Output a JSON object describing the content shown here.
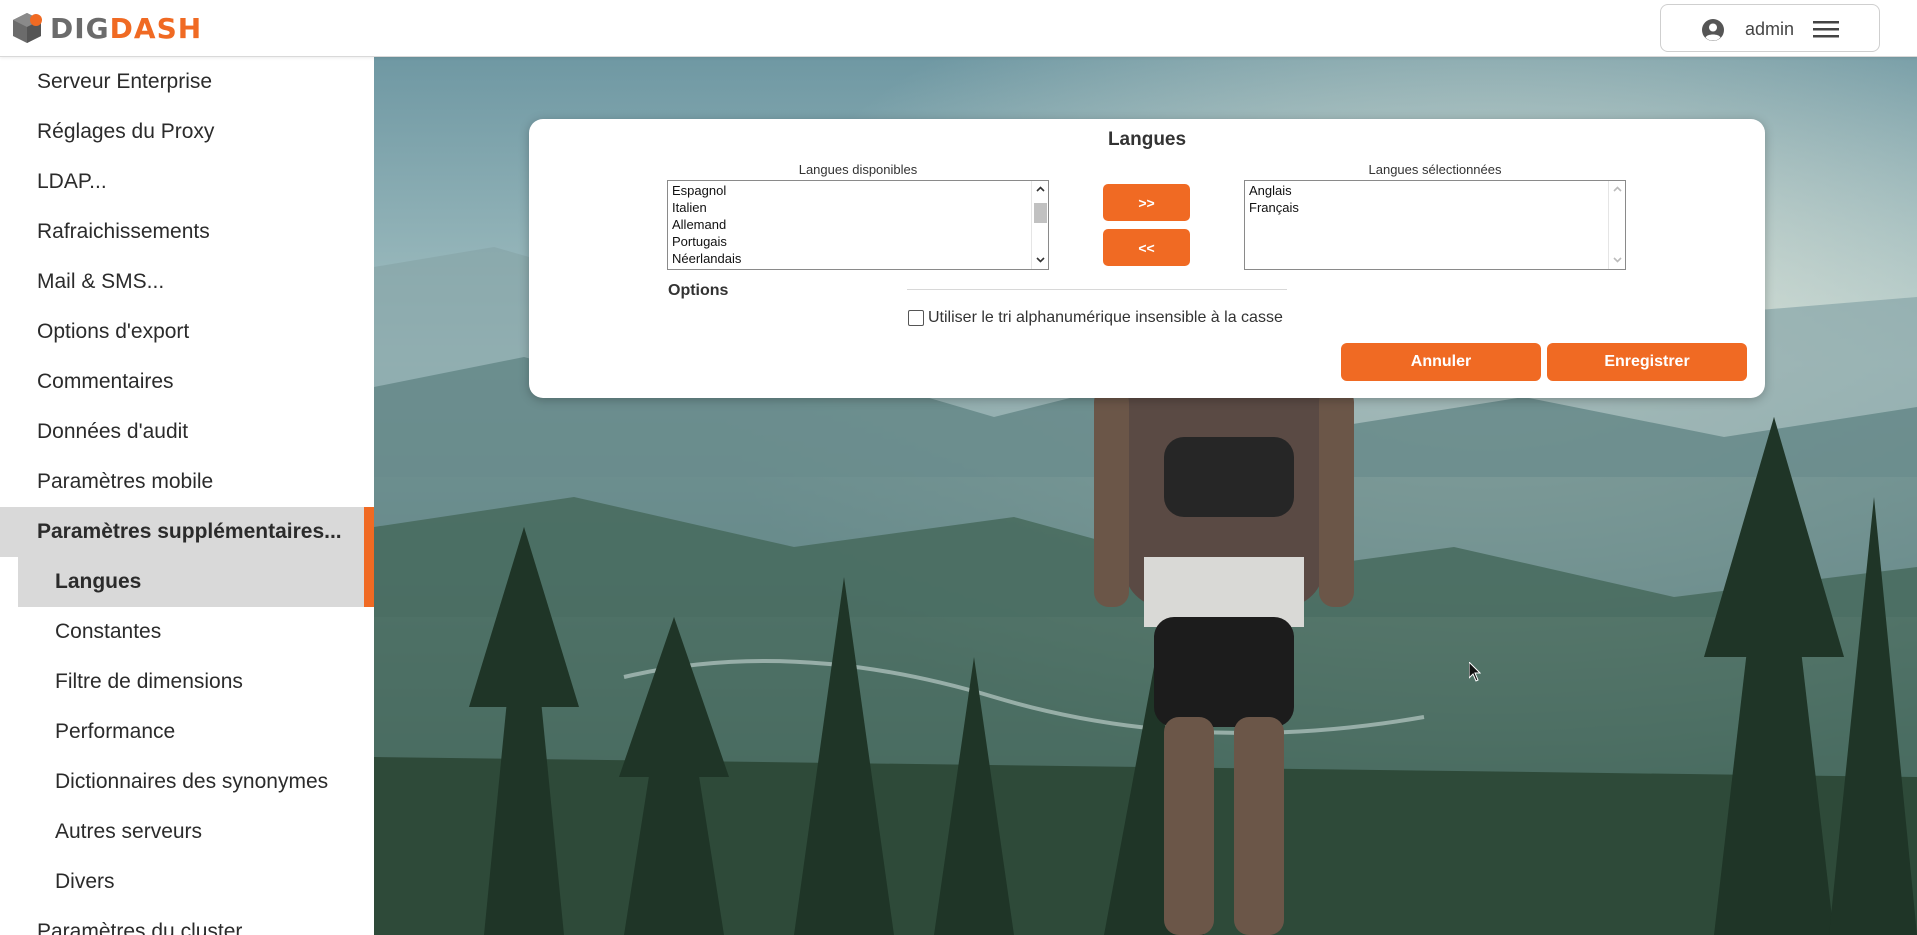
{
  "header": {
    "logo_part1": "DIG",
    "logo_part2": "DASH",
    "user_name": "admin",
    "accent_color": "#f06a23"
  },
  "sidebar": {
    "items": [
      {
        "label": "Serveur Enterprise"
      },
      {
        "label": "Réglages du Proxy"
      },
      {
        "label": "LDAP..."
      },
      {
        "label": "Rafraichissements"
      },
      {
        "label": "Mail & SMS..."
      },
      {
        "label": "Options d'export"
      },
      {
        "label": "Commentaires"
      },
      {
        "label": "Données d'audit"
      },
      {
        "label": "Paramètres mobile"
      },
      {
        "label": "Paramètres supplémentaires..."
      },
      {
        "label": "Paramètres du cluster"
      }
    ],
    "sub_items": [
      {
        "label": "Langues"
      },
      {
        "label": "Constantes"
      },
      {
        "label": "Filtre de dimensions"
      },
      {
        "label": "Performance"
      },
      {
        "label": "Dictionnaires des synonymes"
      },
      {
        "label": "Autres serveurs"
      },
      {
        "label": "Divers"
      }
    ],
    "active_parent": "Paramètres supplémentaires...",
    "active_item": "Langues"
  },
  "dialog": {
    "title": "Langues",
    "available_label": "Langues disponibles",
    "available": [
      "Espagnol",
      "Italien",
      "Allemand",
      "Portugais",
      "Néerlandais"
    ],
    "selected_label": "Langues sélectionnées",
    "selected": [
      "Anglais",
      "Français"
    ],
    "add_button": ">>",
    "remove_button": "<<",
    "options_label": "Options",
    "checkbox_label": "Utiliser le tri alphanumérique insensible à la casse",
    "checkbox_checked": false,
    "cancel_button": "Annuler",
    "save_button": "Enregistrer"
  }
}
